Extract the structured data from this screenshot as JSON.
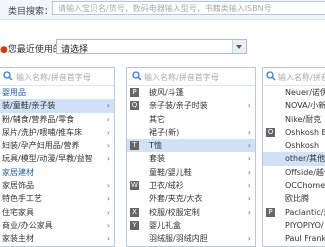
{
  "search": {
    "label": "类目搜索：",
    "placeholder": "请输入宝贝名/货号，数码电器输入型号，书籍类输入ISBN号"
  },
  "recent": {
    "label": "您最近使用的类目：",
    "value": "请选择"
  },
  "col1": {
    "placeholder": "输入名称/拼音首字母",
    "rows": [
      {
        "text": "婴用品",
        "group": true,
        "chev": false,
        "selected": false
      },
      {
        "text": "装/童鞋/亲子装",
        "group": false,
        "chev": true,
        "selected": true
      },
      {
        "text": "粉/辅食/营养品/零食",
        "group": false,
        "chev": true,
        "selected": false
      },
      {
        "text": "尿片/洗护/喂哺/推车床",
        "group": false,
        "chev": true,
        "selected": false
      },
      {
        "text": "妇装/孕产妇用品/营养",
        "group": false,
        "chev": true,
        "selected": false
      },
      {
        "text": "玩具/模型/动漫/早教/益智",
        "group": false,
        "chev": true,
        "selected": false
      },
      {
        "text": "家居建材",
        "group": true,
        "chev": false,
        "selected": false
      },
      {
        "text": "家居饰品",
        "group": false,
        "chev": true,
        "selected": false
      },
      {
        "text": "特色手工艺",
        "group": false,
        "chev": true,
        "selected": false
      },
      {
        "text": "住宅家具",
        "group": false,
        "chev": true,
        "selected": false
      },
      {
        "text": "商业/办公家具",
        "group": false,
        "chev": true,
        "selected": false
      },
      {
        "text": "家装主材",
        "group": false,
        "chev": true,
        "selected": false
      }
    ]
  },
  "col2": {
    "placeholder": "输入名称/拼音首字母",
    "rows": [
      {
        "letter": "P",
        "text": "披风/斗篷",
        "chev": false,
        "selected": false
      },
      {
        "letter": "Q",
        "text": "亲子装/亲子时装",
        "chev": true,
        "selected": false
      },
      {
        "letter": "",
        "text": "其它",
        "chev": false,
        "selected": false
      },
      {
        "letter": "",
        "text": "裙子(新)",
        "chev": true,
        "selected": false
      },
      {
        "letter": "T",
        "text": "T恤",
        "chev": true,
        "selected": true
      },
      {
        "letter": "",
        "text": "套装",
        "chev": true,
        "selected": false
      },
      {
        "letter": "",
        "text": "童鞋/婴儿鞋",
        "chev": true,
        "selected": false
      },
      {
        "letter": "W",
        "text": "卫衣/绒衫",
        "chev": true,
        "selected": false
      },
      {
        "letter": "",
        "text": "外套/夹克/大衣",
        "chev": true,
        "selected": false
      },
      {
        "letter": "X",
        "text": "校服/校服定制",
        "chev": true,
        "selected": false
      },
      {
        "letter": "Y",
        "text": "婴儿礼盒",
        "chev": false,
        "selected": false
      },
      {
        "letter": "",
        "text": "羽绒服/羽绒内胆",
        "chev": true,
        "selected": false
      }
    ]
  },
  "col3": {
    "placeholder": "输入名称/拼音首字母",
    "rows": [
      {
        "text": "Neuer/诺伊",
        "selected": false
      },
      {
        "text": "NOVA/小新",
        "selected": false
      },
      {
        "text": "Nike/耐克",
        "selected": false
      },
      {
        "letter": "O",
        "text": "Oshkosh B'",
        "selected": false
      },
      {
        "text": "Oshkosh",
        "selected": false
      },
      {
        "text": "other/其他",
        "selected": true
      },
      {
        "text": "Offside/越位",
        "selected": false
      },
      {
        "text": "OCChome/言",
        "selected": false
      },
      {
        "text": "欧比腾",
        "selected": false
      },
      {
        "letter": "P",
        "text": "Paclantic/派",
        "selected": false
      },
      {
        "text": "PIYOPIYO/",
        "selected": false
      },
      {
        "text": "Paul Frank",
        "selected": false
      }
    ]
  },
  "colors": {
    "accent": "#1f5fa8",
    "selected_bg": "#cfe2f7",
    "highlight": "#d4380d"
  }
}
